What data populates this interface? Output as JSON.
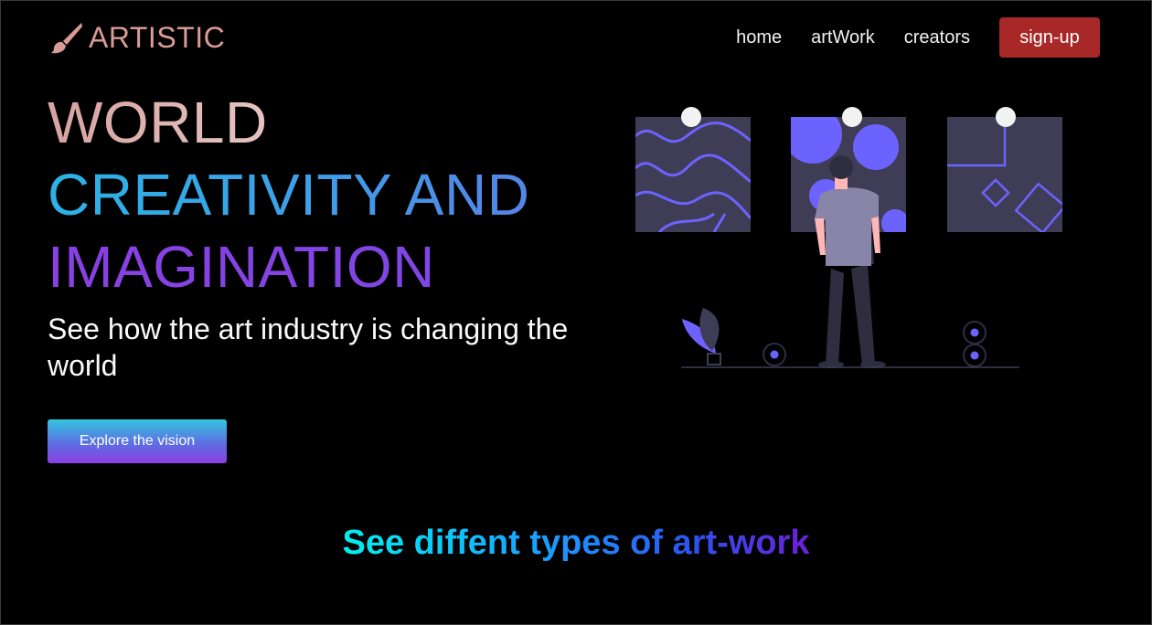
{
  "brand": {
    "name": "ARTISTIC",
    "logo_icon": "paintbrush-icon",
    "color": "#d99b96"
  },
  "nav": {
    "links": [
      "home",
      "artWork",
      "creators"
    ],
    "signup_label": "sign-up",
    "signup_color": "#a82727"
  },
  "hero": {
    "line1": "WORLD",
    "line2": "CREATIVITY AND",
    "line3": "IMAGINATION",
    "subtitle": "See how the art industry is changing the world",
    "cta_label": "Explore the vision"
  },
  "illustration": {
    "name": "person-viewing-art-gallery-illustration",
    "accent": "#6c63ff"
  },
  "section": {
    "heading": "See diffent types of art-work"
  }
}
